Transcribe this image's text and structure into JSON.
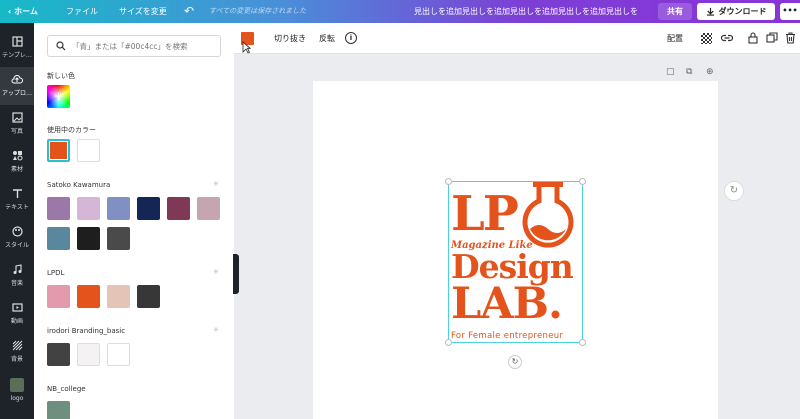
{
  "topbar": {
    "home": "ホーム",
    "file": "ファイル",
    "resize": "サイズを変更",
    "saved_status": "すべての変更は保存されました",
    "doc_title": "見出しを追加見出しを追加見出しを追加見出しを追加見出しを",
    "share": "共有",
    "download": "ダウンロード",
    "more": "•••"
  },
  "rail": {
    "items": [
      {
        "label": "テンプレ…",
        "icon": "template-icon"
      },
      {
        "label": "アップロ…",
        "icon": "upload-icon"
      },
      {
        "label": "写真",
        "icon": "photo-icon"
      },
      {
        "label": "素材",
        "icon": "elements-icon"
      },
      {
        "label": "テキスト",
        "icon": "text-icon"
      },
      {
        "label": "スタイル",
        "icon": "style-icon"
      },
      {
        "label": "音楽",
        "icon": "music-icon"
      },
      {
        "label": "動画",
        "icon": "video-icon"
      },
      {
        "label": "背景",
        "icon": "background-icon"
      },
      {
        "label": "logo",
        "icon": "logo-thumb"
      }
    ]
  },
  "panel": {
    "search_placeholder": "「青」または「#00c4cc」を検索",
    "new_color_label": "新しい色",
    "in_use_label": "使用中のカラー",
    "in_use_colors": [
      "#e4531c",
      "#ffffff"
    ],
    "palettes": [
      {
        "name": "Satoko Kawamura",
        "colors": [
          "#9b78a8",
          "#d6b6d6",
          "#8090c2",
          "#132655",
          "#7f3957",
          "#c5a5b0",
          "#58879e",
          "#1e1e1e",
          "#4a4a4a"
        ]
      },
      {
        "name": "LPDL",
        "colors": [
          "#e39aac",
          "#e4531c",
          "#e4c4b7",
          "#373737"
        ]
      },
      {
        "name": "irodori Branding_basic",
        "colors": [
          "#424242",
          "#f4f2f2",
          "#ffffff"
        ]
      },
      {
        "name": "NB_college",
        "colors": [
          "#6e8e7e"
        ]
      }
    ]
  },
  "context_toolbar": {
    "color": "#e4531c",
    "crop": "切り抜き",
    "flip": "反転",
    "info": "i",
    "position": "配置"
  },
  "logo": {
    "line1": "LP",
    "tagline": "Magazine Like",
    "line2": "Design",
    "line3": "LAB.",
    "footer": "For Female entrepreneur",
    "color": "#e4531c"
  }
}
